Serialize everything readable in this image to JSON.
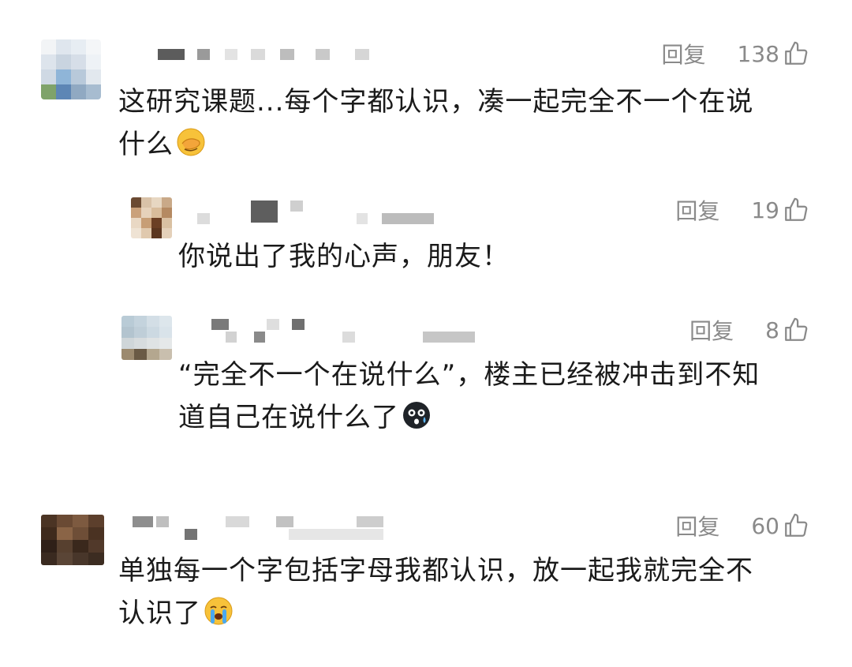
{
  "comments": [
    {
      "reply_label": "回复",
      "like_count": "138",
      "text_line1": "这研究课题...每个字都认识，凑一起完全不一个在说",
      "text_line2": "什么",
      "emoji": "facepalm-emoji"
    },
    {
      "reply_label": "回复",
      "like_count": "19",
      "text_line1": "你说出了我的心声，朋友！"
    },
    {
      "reply_label": "回复",
      "like_count": "8",
      "text_line1": "“完全不一个在说什么”，楼主已经被冲击到不知",
      "text_line2": "道自己在说什么了",
      "emoji": "shocked-crying-emoji"
    },
    {
      "reply_label": "回复",
      "like_count": "60",
      "text_line1": "单独每一个字包括字母我都认识，放一起我就完全不",
      "text_line2": "认识了",
      "emoji": "loudly-crying-emoji"
    }
  ],
  "colors": {
    "text": "#1a1a1a",
    "meta": "#8a8a8a",
    "background": "#ffffff"
  }
}
